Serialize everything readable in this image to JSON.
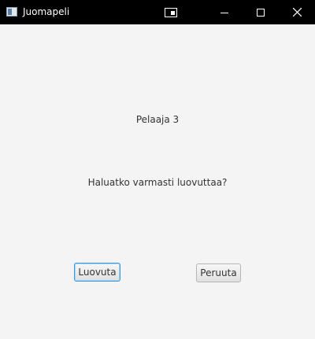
{
  "window": {
    "title": "Juomapeli"
  },
  "dialog": {
    "player_label": "Pelaaja 3",
    "question": "Haluatko varmasti luovuttaa?",
    "confirm_button": "Luovuta",
    "cancel_button": "Peruuta"
  },
  "icons": {
    "app": "app-window-icon",
    "snap": "snap-layout-icon",
    "minimize": "minimize-icon",
    "maximize": "maximize-icon",
    "close": "close-icon"
  },
  "colors": {
    "titlebar": "#000000",
    "background": "#f4f4f4",
    "focus_border": "#3c97d6"
  }
}
